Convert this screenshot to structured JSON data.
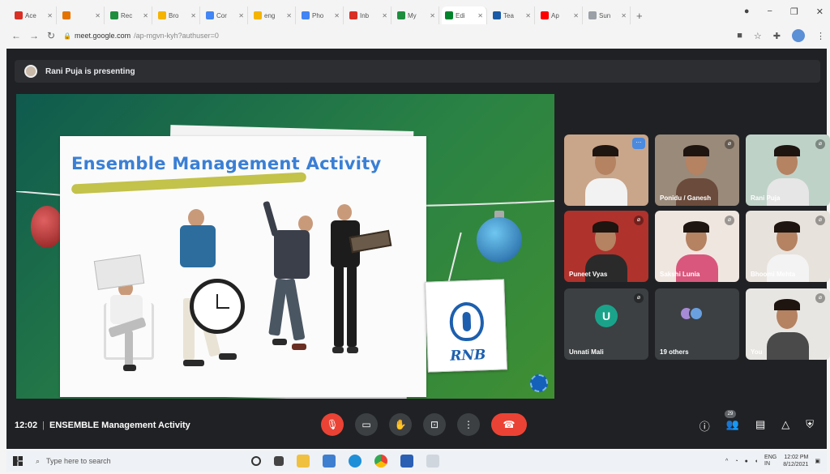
{
  "browser": {
    "tabs": [
      {
        "label": "Ace",
        "icon": "gmail-icon",
        "color": "#d93025"
      },
      {
        "label": "",
        "icon": "chrome-app-icon",
        "color": "#e37400"
      },
      {
        "label": "Rec",
        "icon": "drive-icon",
        "color": "#1e8e3e"
      },
      {
        "label": "Bro",
        "icon": "slides-icon",
        "color": "#f4b400"
      },
      {
        "label": "Cor",
        "icon": "docs-icon",
        "color": "#4285f4"
      },
      {
        "label": "eng",
        "icon": "slides-icon",
        "color": "#f4b400"
      },
      {
        "label": "Pho",
        "icon": "docs-icon",
        "color": "#4285f4"
      },
      {
        "label": "Inb",
        "icon": "gmail-icon",
        "color": "#d93025"
      },
      {
        "label": "My",
        "icon": "drive-icon",
        "color": "#1e8e3e"
      },
      {
        "label": "Edi",
        "icon": "meet-icon",
        "color": "#00832d"
      },
      {
        "label": "Tea",
        "icon": "v-icon",
        "color": "#1a5aa6"
      },
      {
        "label": "Ap",
        "icon": "youtube-icon",
        "color": "#ff0000"
      },
      {
        "label": "Sun",
        "icon": "page-icon",
        "color": "#9aa0a6"
      }
    ],
    "new_tab": "+",
    "url_host": "meet.google.com",
    "url_path": "/ap-mgvn-kyh?authuser=0"
  },
  "meet": {
    "presenting_text": "Rani Puja is presenting",
    "slide": {
      "title": "Ensemble Management Activity",
      "logo_text": "RNB"
    },
    "participants": [
      {
        "name": "",
        "kind": "video",
        "bg": "#c9a58a",
        "body": "#f2f2f2",
        "speaking": true
      },
      {
        "name": "Ponidu / Ganesh",
        "kind": "video",
        "bg": "#9a8a7a",
        "body": "#6b4b3b",
        "speaking": false
      },
      {
        "name": "Rani Puja",
        "kind": "video",
        "bg": "#bfd2c8",
        "body": "#e6e6e6",
        "speaking": false
      },
      {
        "name": "Puneet Vyas",
        "kind": "video",
        "bg": "#b0322c",
        "body": "#2a2a2a",
        "speaking": false
      },
      {
        "name": "Sakshi Lunia",
        "kind": "video",
        "bg": "#f0e6e0",
        "body": "#d9577d",
        "speaking": false
      },
      {
        "name": "Bhoomi Mehta",
        "kind": "video",
        "bg": "#e8e2dc",
        "body": "#f3f3f3",
        "speaking": false
      },
      {
        "name": "Unnati Mali",
        "kind": "avatar",
        "letter": "U"
      },
      {
        "name": "19 others",
        "kind": "others"
      },
      {
        "name": "You",
        "kind": "video",
        "bg": "#e8e6e2",
        "body": "#4a4a4a",
        "speaking": false
      }
    ],
    "meeting_time": "12:02",
    "meeting_title": "ENSEMBLE Management Activity",
    "people_count": "29"
  },
  "taskbar": {
    "search_placeholder": "Type here to search",
    "time": "12:02 PM",
    "date": "8/12/2021",
    "lang": "ENG\nIN"
  }
}
